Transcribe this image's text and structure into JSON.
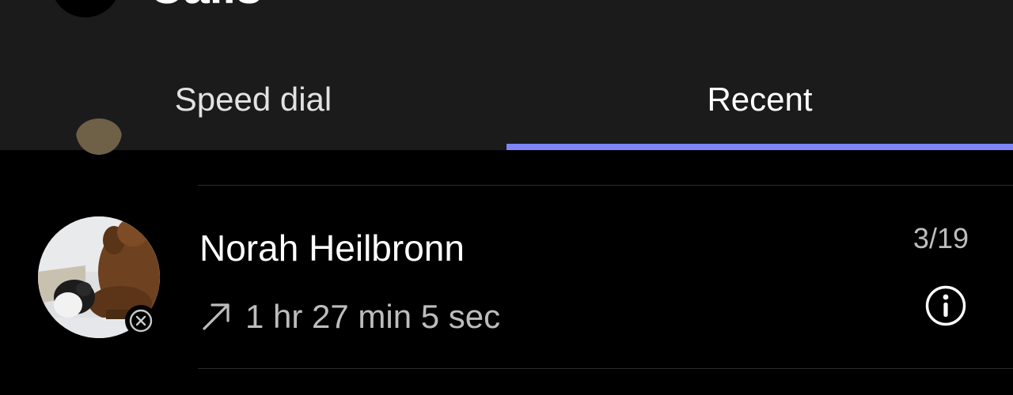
{
  "header": {
    "title": "Calls"
  },
  "tabs": [
    {
      "label": "Speed dial",
      "active": false
    },
    {
      "label": "Recent",
      "active": true
    }
  ],
  "colors": {
    "accent": "#7f85f5",
    "background": "#000000",
    "header_background": "#1b1b1b",
    "primary_text": "#ffffff",
    "secondary_text": "#bdbdbd"
  },
  "recent_calls": [
    {
      "name": "Norah Heilbronn",
      "date": "3/19",
      "direction_icon": "outgoing-arrow-icon",
      "duration": "1 hr 27 min 5 sec",
      "presence_icon": "offline-presence-icon",
      "action_icon": "info-icon"
    }
  ]
}
